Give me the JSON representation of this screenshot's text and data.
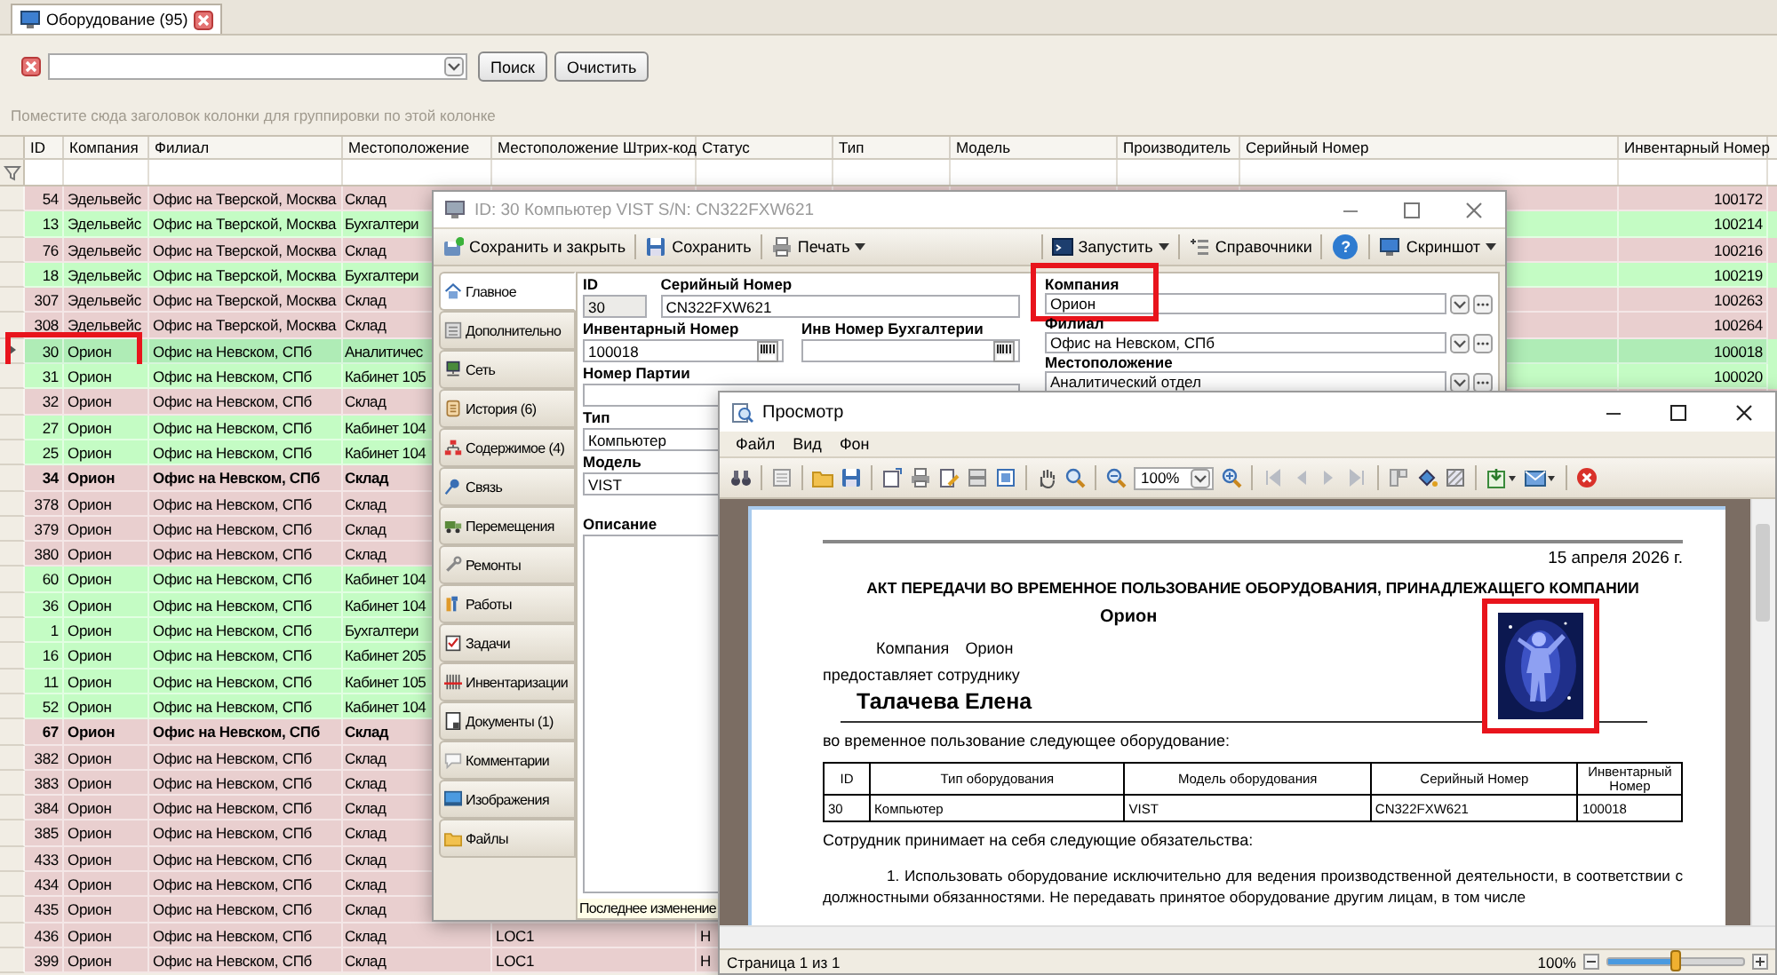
{
  "document_tab": {
    "label": "Оборудование (95)",
    "selected": true
  },
  "search": {
    "buttons": [
      "Поиск",
      "Очистить"
    ]
  },
  "group_hint": "Поместите сюда заголовок колонки для группировки по этой колонке",
  "grid": {
    "columns": [
      "ID",
      "Компания",
      "Филиал",
      "Местоположение",
      "Местоположение Штрих-код",
      "Статус",
      "Тип",
      "Модель",
      "Производитель",
      "Серийный Номер",
      "Инвентарный Номер"
    ],
    "rows": [
      {
        "id": "54",
        "company": "Эдельвейс",
        "branch": "Офис на Тверской, Москва",
        "location": "Склад",
        "inventory": "100172",
        "color": "#e9cfcf",
        "bold": false,
        "selected": false,
        "highlighted": false
      },
      {
        "id": "13",
        "company": "Эдельвейс",
        "branch": "Офис на Тверской, Москва",
        "location": "Бухгалтери",
        "inventory": "100214",
        "color": "#c4fcc4",
        "bold": false,
        "selected": false,
        "highlighted": false
      },
      {
        "id": "76",
        "company": "Эдельвейс",
        "branch": "Офис на Тверской, Москва",
        "location": "Склад",
        "inventory": "100216",
        "color": "#e9cfcf",
        "bold": false,
        "selected": false,
        "highlighted": false
      },
      {
        "id": "18",
        "company": "Эдельвейс",
        "branch": "Офис на Тверской, Москва",
        "location": "Бухгалтери",
        "inventory": "100219",
        "color": "#c4fcc4",
        "bold": false,
        "selected": false,
        "highlighted": false
      },
      {
        "id": "307",
        "company": "Эдельвейс",
        "branch": "Офис на Тверской, Москва",
        "location": "Склад",
        "inventory": "100263",
        "color": "#e9cfcf",
        "bold": false,
        "selected": false,
        "highlighted": false
      },
      {
        "id": "308",
        "company": "Эдельвейс",
        "branch": "Офис на Тверской, Москва",
        "location": "Склад",
        "inventory": "100264",
        "color": "#e9cfcf",
        "bold": false,
        "selected": false,
        "highlighted": false
      },
      {
        "id": "30",
        "company": "Орион",
        "branch": "Офис на Невском, СПб",
        "location": "Аналитичес",
        "inventory": "100018",
        "color": "#c4fcc4",
        "bold": false,
        "selected": true,
        "highlighted": true
      },
      {
        "id": "31",
        "company": "Орион",
        "branch": "Офис на Невском, СПб",
        "location": "Кабинет 105",
        "inventory": "100020",
        "color": "#c4fcc4",
        "bold": false,
        "selected": false,
        "highlighted": false
      },
      {
        "id": "32",
        "company": "Орион",
        "branch": "Офис на Невском, СПб",
        "location": "Склад",
        "color": "#e9cfcf",
        "bold": false,
        "selected": false,
        "highlighted": false
      },
      {
        "id": "27",
        "company": "Орион",
        "branch": "Офис на Невском, СПб",
        "location": "Кабинет 104",
        "color": "#c4fcc4",
        "bold": false,
        "selected": false,
        "highlighted": false
      },
      {
        "id": "25",
        "company": "Орион",
        "branch": "Офис на Невском, СПб",
        "location": "Кабинет 104",
        "color": "#c4fcc4",
        "bold": false,
        "selected": false,
        "highlighted": false
      },
      {
        "id": "34",
        "company": "Орион",
        "branch": "Офис на Невском, СПб",
        "location": "Склад",
        "color": "#e9cfcf",
        "bold": true,
        "selected": false,
        "highlighted": false
      },
      {
        "id": "378",
        "company": "Орион",
        "branch": "Офис на Невском, СПб",
        "location": "Склад",
        "color": "#e9cfcf",
        "bold": false,
        "selected": false,
        "highlighted": false
      },
      {
        "id": "379",
        "company": "Орион",
        "branch": "Офис на Невском, СПб",
        "location": "Склад",
        "color": "#e9cfcf",
        "bold": false,
        "selected": false,
        "highlighted": false
      },
      {
        "id": "380",
        "company": "Орион",
        "branch": "Офис на Невском, СПб",
        "location": "Склад",
        "color": "#e9cfcf",
        "bold": false,
        "selected": false,
        "highlighted": false
      },
      {
        "id": "60",
        "company": "Орион",
        "branch": "Офис на Невском, СПб",
        "location": "Кабинет 104",
        "color": "#c4fcc4",
        "bold": false,
        "selected": false,
        "highlighted": false
      },
      {
        "id": "36",
        "company": "Орион",
        "branch": "Офис на Невском, СПб",
        "location": "Кабинет 104",
        "color": "#c4fcc4",
        "bold": false,
        "selected": false,
        "highlighted": false
      },
      {
        "id": "1",
        "company": "Орион",
        "branch": "Офис на Невском, СПб",
        "location": "Бухгалтери",
        "color": "#c4fcc4",
        "bold": false,
        "selected": false,
        "highlighted": false
      },
      {
        "id": "16",
        "company": "Орион",
        "branch": "Офис на Невском, СПб",
        "location": "Кабинет 205",
        "color": "#c4fcc4",
        "bold": false,
        "selected": false,
        "highlighted": false
      },
      {
        "id": "11",
        "company": "Орион",
        "branch": "Офис на Невском, СПб",
        "location": "Кабинет 105",
        "color": "#c4fcc4",
        "bold": false,
        "selected": false,
        "highlighted": false
      },
      {
        "id": "52",
        "company": "Орион",
        "branch": "Офис на Невском, СПб",
        "location": "Кабинет 104",
        "color": "#c4fcc4",
        "bold": false,
        "selected": false,
        "highlighted": false
      },
      {
        "id": "67",
        "company": "Орион",
        "branch": "Офис на Невском, СПб",
        "location": "Склад",
        "color": "#e9cfcf",
        "bold": true,
        "selected": false,
        "highlighted": false
      },
      {
        "id": "382",
        "company": "Орион",
        "branch": "Офис на Невском, СПб",
        "location": "Склад",
        "color": "#e9cfcf",
        "bold": false,
        "selected": false,
        "highlighted": false
      },
      {
        "id": "383",
        "company": "Орион",
        "branch": "Офис на Невском, СПб",
        "location": "Склад",
        "color": "#e9cfcf",
        "bold": false,
        "selected": false,
        "highlighted": false
      },
      {
        "id": "384",
        "company": "Орион",
        "branch": "Офис на Невском, СПб",
        "location": "Склад",
        "color": "#e9cfcf",
        "bold": false,
        "selected": false,
        "highlighted": false
      },
      {
        "id": "385",
        "company": "Орион",
        "branch": "Офис на Невском, СПб",
        "location": "Склад",
        "color": "#e9cfcf",
        "bold": false,
        "selected": false,
        "highlighted": false
      },
      {
        "id": "433",
        "company": "Орион",
        "branch": "Офис на Невском, СПб",
        "location": "Склад",
        "color": "#e9cfcf",
        "bold": false,
        "selected": false,
        "highlighted": false
      },
      {
        "id": "434",
        "company": "Орион",
        "branch": "Офис на Невском, СПб",
        "location": "Склад",
        "color": "#e9cfcf",
        "bold": false,
        "selected": false,
        "highlighted": false
      },
      {
        "id": "435",
        "company": "Орион",
        "branch": "Офис на Невском, СПб",
        "location": "Склад",
        "color": "#e9cfcf",
        "bold": false,
        "selected": false,
        "highlighted": false
      },
      {
        "id": "436",
        "company": "Орион",
        "branch": "Офис на Невском, СПб",
        "location": "Склад",
        "barcode": "LOC1",
        "status": "Н",
        "color": "#e9cfcf",
        "bold": false,
        "selected": false,
        "highlighted": false
      },
      {
        "id": "399",
        "company": "Орион",
        "branch": "Офис на Невском, СПб",
        "location": "Склад",
        "barcode": "LOC1",
        "status": "Н",
        "color": "#e9cfcf",
        "bold": false,
        "selected": false,
        "highlighted": false
      }
    ]
  },
  "editor": {
    "title": "ID: 30  Компьютер VIST S/N: CN322FXW621",
    "toolbar_left": [
      {
        "kind": "button",
        "label": "Сохранить и закрыть",
        "menu": false
      },
      {
        "kind": "button",
        "label": "Сохранить",
        "menu": false
      },
      {
        "kind": "button",
        "label": "Печать",
        "menu": true
      }
    ],
    "toolbar_right": [
      {
        "kind": "button",
        "label": "Запустить",
        "menu": true
      },
      {
        "kind": "button",
        "label": "Справочники",
        "menu": false
      },
      {
        "kind": "help",
        "label": "?"
      },
      {
        "kind": "button",
        "label": "Скриншот",
        "menu": true
      }
    ],
    "tabs": [
      {
        "label": "Главное",
        "selected": true
      },
      {
        "label": "Дополнительно",
        "selected": false
      },
      {
        "label": "Сеть",
        "selected": false
      },
      {
        "label": "История (6)",
        "selected": false
      },
      {
        "label": "Содержимое (4)",
        "selected": false
      },
      {
        "label": "Связь",
        "selected": false
      },
      {
        "label": "Перемещения",
        "selected": false
      },
      {
        "label": "Ремонты",
        "selected": false
      },
      {
        "label": "Работы",
        "selected": false
      },
      {
        "label": "Задачи",
        "selected": false
      },
      {
        "label": "Инвентаризации",
        "selected": false
      },
      {
        "label": "Документы (1)",
        "selected": false
      },
      {
        "label": "Комментарии",
        "selected": false
      },
      {
        "label": "Изображения",
        "selected": false
      },
      {
        "label": "Файлы",
        "selected": false
      }
    ],
    "fields": {
      "id": {
        "label": "ID",
        "value": "30",
        "disabled": true
      },
      "serial": {
        "label": "Серийный Номер",
        "value": "CN322FXW621",
        "disabled": false
      },
      "inventory": {
        "label": "Инвентарный Номер",
        "value": "100018",
        "disabled": false
      },
      "accounting": {
        "label": "Инв Номер Бухгалтерии",
        "disabled": false
      },
      "batch": {
        "label": "Номер Партии",
        "disabled": false
      },
      "type": {
        "label": "Тип",
        "value": "Компьютер",
        "disabled": false
      },
      "model": {
        "label": "Модель",
        "value": "VIST",
        "disabled": false
      },
      "description": {
        "label": "Описание"
      }
    },
    "links": [
      {
        "label": "Компания",
        "value": "Орион",
        "highlighted": true
      },
      {
        "label": "Филиал",
        "value": "Офис на Невском, СПб",
        "highlighted": false
      },
      {
        "label": "Местоположение",
        "value": "Аналитический отдел",
        "highlighted": false
      }
    ],
    "status": "Последнее изменение"
  },
  "preview": {
    "title": "Просмотр",
    "menu": [
      "Файл",
      "Вид",
      "Фон"
    ],
    "zoom_value": "100%",
    "document": {
      "date": "15 апреля 2026 г.",
      "heading": "АКТ ПЕРЕДАЧИ ВО ВРЕМЕННОЕ ПОЛЬЗОВАНИЕ ОБОРУДОВАНИЯ, ПРИНАДЛЕЖАЩЕГО КОМПАНИИ",
      "company_title": "Орион",
      "company_label": "Компания",
      "company_name": "Орион",
      "provides": "предоставляет сотруднику",
      "employee": "Талачева Елена",
      "intro": "во временное пользование следующее оборудование:",
      "table": {
        "columns": [
          "ID",
          "Тип оборудования",
          "Модель оборудования",
          "Серийный Номер",
          "Инвентарный Номер"
        ],
        "rows": [
          [
            "30",
            "Компьютер",
            "VIST",
            "CN322FXW621",
            "100018"
          ]
        ]
      },
      "obligations": "Сотрудник принимает на себя следующие обязательства:",
      "clause": "1. Использовать оборудование исключительно для ведения производственной деятельности, в соответствии с должностными обязанностями. Не передавать принятое оборудование другим лицам, в том числе",
      "picture": {
        "kind": "picture",
        "highlighted": true
      }
    },
    "status": {
      "page": "Страница 1 из 1",
      "zoom": "100%",
      "level": 0.5
    }
  }
}
